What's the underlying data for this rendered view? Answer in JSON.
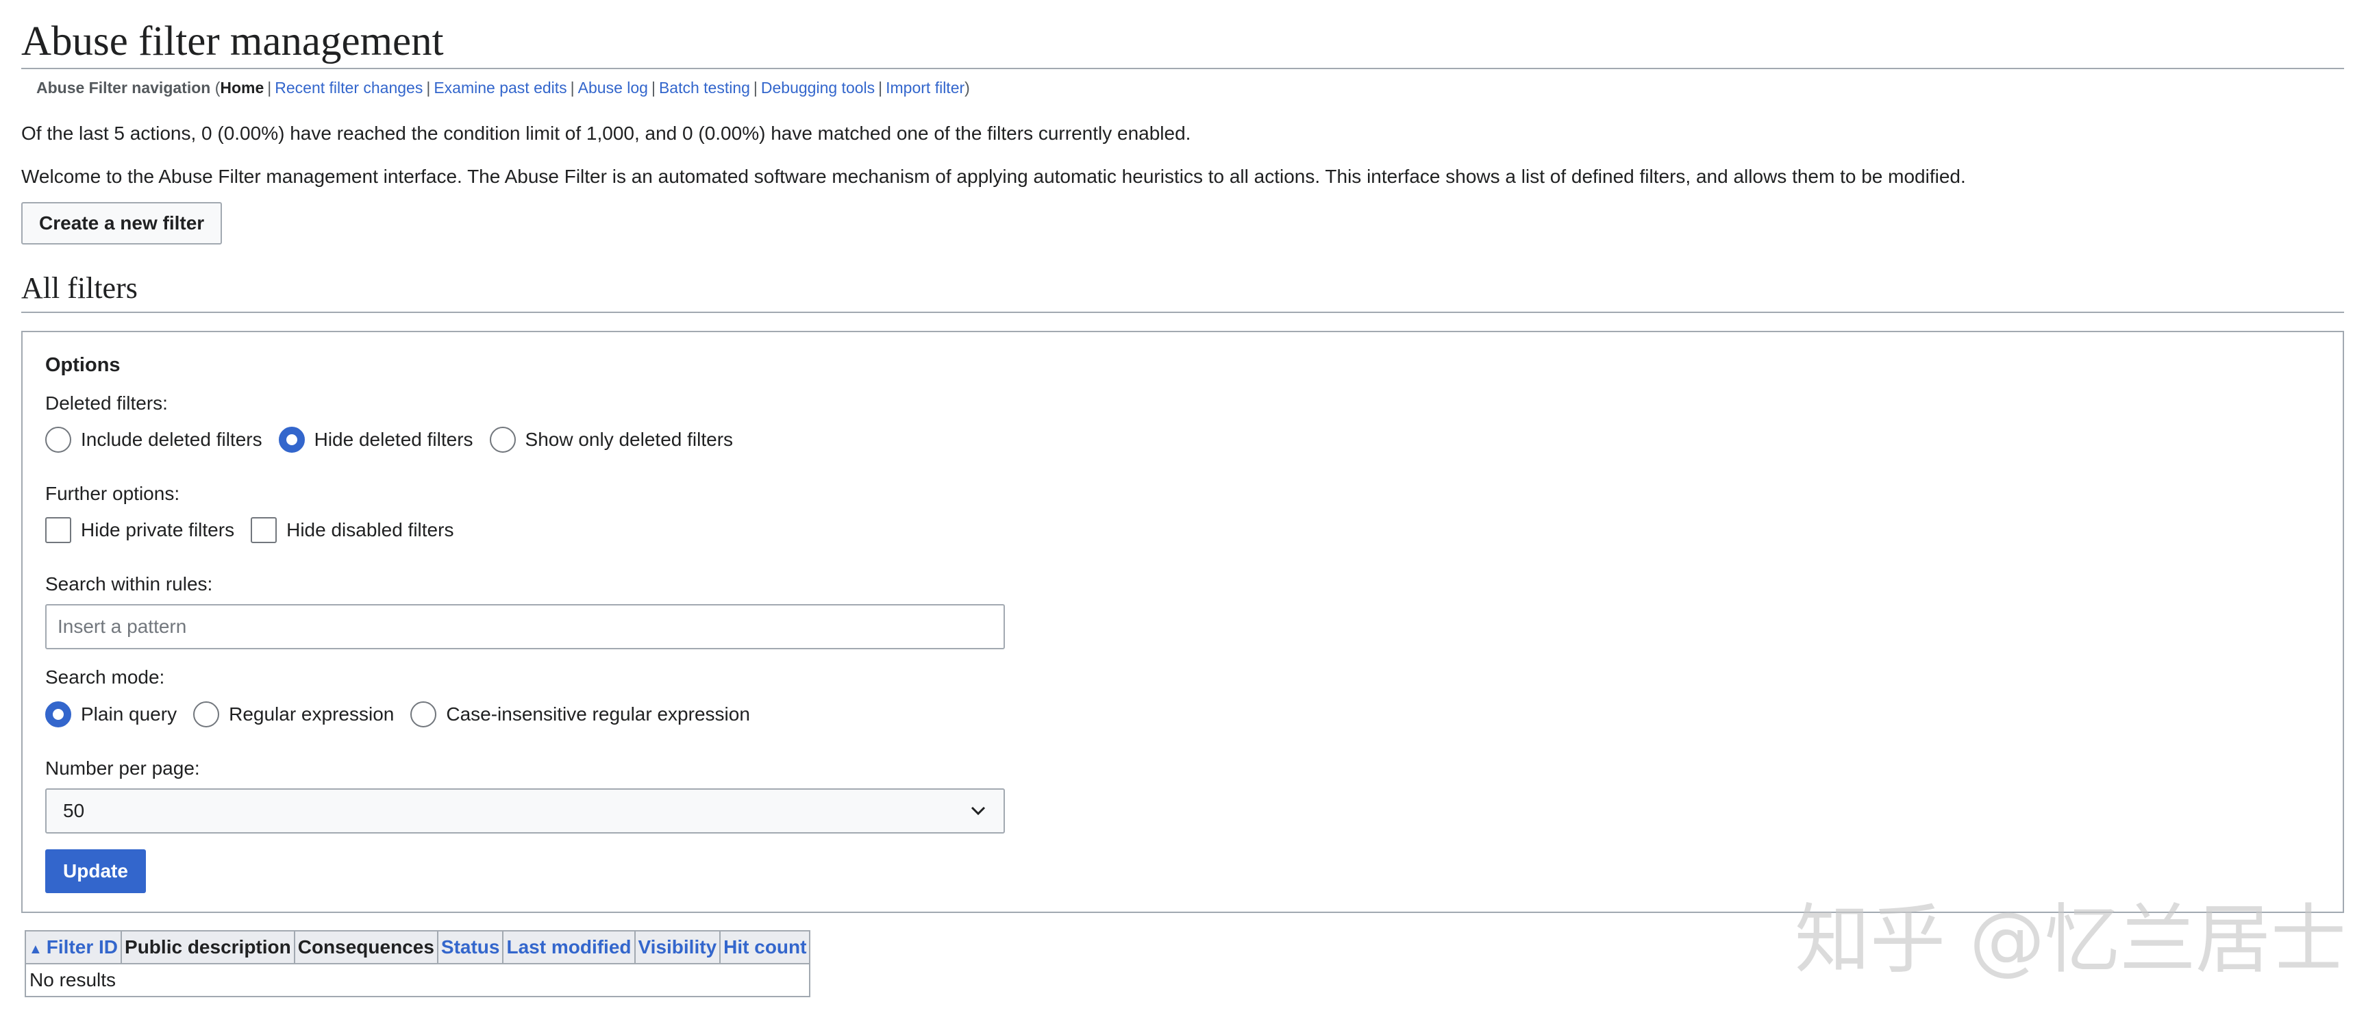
{
  "page": {
    "title": "Abuse filter management",
    "section_title": "All filters"
  },
  "nav": {
    "label": "Abuse Filter navigation",
    "open_paren": "(",
    "close_paren": ")",
    "separator": "|",
    "items": [
      {
        "label": "Home",
        "current": true
      },
      {
        "label": "Recent filter changes"
      },
      {
        "label": "Examine past edits"
      },
      {
        "label": "Abuse log"
      },
      {
        "label": "Batch testing"
      },
      {
        "label": "Debugging tools"
      },
      {
        "label": "Import filter"
      }
    ]
  },
  "stats_text": "Of the last 5 actions, 0 (0.00%) have reached the condition limit of 1,000, and 0 (0.00%) have matched one of the filters currently enabled.",
  "intro_text": "Welcome to the Abuse Filter management interface. The Abuse Filter is an automated software mechanism of applying automatic heuristics to all actions. This interface shows a list of defined filters, and allows them to be modified.",
  "create_button": "Create a new filter",
  "options": {
    "legend": "Options",
    "deleted_label": "Deleted filters:",
    "deleted_choices": [
      {
        "label": "Include deleted filters",
        "selected": false
      },
      {
        "label": "Hide deleted filters",
        "selected": true
      },
      {
        "label": "Show only deleted filters",
        "selected": false
      }
    ],
    "further_label": "Further options:",
    "further_choices": [
      {
        "label": "Hide private filters",
        "checked": false
      },
      {
        "label": "Hide disabled filters",
        "checked": false
      }
    ],
    "search_label": "Search within rules:",
    "search_placeholder": "Insert a pattern",
    "search_value": "",
    "mode_label": "Search mode:",
    "mode_choices": [
      {
        "label": "Plain query",
        "selected": true
      },
      {
        "label": "Regular expression",
        "selected": false
      },
      {
        "label": "Case-insensitive regular expression",
        "selected": false
      }
    ],
    "per_page_label": "Number per page:",
    "per_page_value": "50",
    "update_button": "Update"
  },
  "table": {
    "columns": [
      {
        "label": "Filter ID",
        "sortable": true,
        "sorted": "ascending"
      },
      {
        "label": "Public description",
        "sortable": false
      },
      {
        "label": "Consequences",
        "sortable": false
      },
      {
        "label": "Status",
        "sortable": true
      },
      {
        "label": "Last modified",
        "sortable": true
      },
      {
        "label": "Visibility",
        "sortable": true
      },
      {
        "label": "Hit count",
        "sortable": true
      }
    ],
    "empty_text": "No results"
  },
  "watermark": "知乎 @忆兰居士",
  "colors": {
    "link": "#3366cc",
    "border": "#a2a9b1",
    "primary_button": "#3366cc",
    "text": "#202122"
  }
}
